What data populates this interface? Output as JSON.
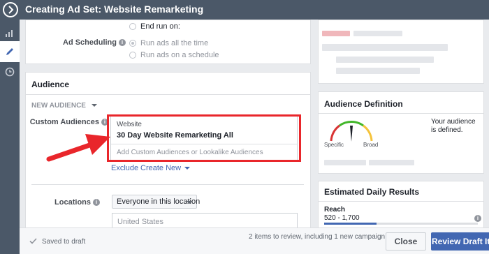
{
  "header": {
    "title": "Creating Ad Set: Website Remarketing"
  },
  "rail": {
    "items": [
      "chart-icon",
      "pencil-icon",
      "clock-icon"
    ]
  },
  "schedule": {
    "end_run_label": "End run on:",
    "label": "Ad Scheduling",
    "option1": "Run ads all the time",
    "option2": "Run ads on a schedule"
  },
  "audience": {
    "title": "Audience",
    "new_audience": "NEW AUDIENCE",
    "custom_label": "Custom Audiences",
    "category": "Website",
    "selected": "30 Day Website Remarketing All",
    "placeholder": "Add Custom Audiences or Lookalike Audiences",
    "exclude": "Exclude",
    "create_new": "Create New",
    "locations_label": "Locations",
    "location_select": "Everyone in this location",
    "location_value": "United States"
  },
  "definition": {
    "title": "Audience Definition",
    "specific": "Specific",
    "broad": "Broad",
    "message": "Your audience is defined."
  },
  "results": {
    "title": "Estimated Daily Results",
    "reach_label": "Reach",
    "reach_value": "520 - 1,700"
  },
  "footer": {
    "saved": "Saved to draft",
    "review_info": "2 items to review, including 1 new campaign",
    "close": "Close",
    "review": "Review Draft Items"
  },
  "colors": {
    "accent": "#4267b2",
    "header": "#4b5868",
    "highlight": "#e9262b"
  }
}
